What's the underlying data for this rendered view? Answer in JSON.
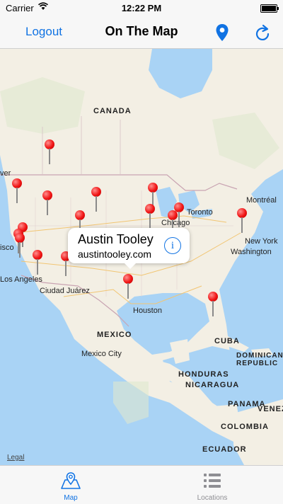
{
  "status_bar": {
    "carrier": "Carrier",
    "time": "12:22 PM"
  },
  "nav": {
    "logout_label": "Logout",
    "title": "On The Map"
  },
  "map": {
    "labels": {
      "canada": "CANADA",
      "montreal": "Montréal",
      "toronto": "Toronto",
      "chicago": "Chicago",
      "new_york": "New York",
      "washington": "Washington",
      "los_angeles": "Los Angeles",
      "ciudad_juarez": "Ciudad Juárez",
      "houston": "Houston",
      "mexico": "MEXICO",
      "mexico_city": "Mexico City",
      "cuba": "CUBA",
      "dominican_republic": "DOMINICAN REPUBLIC",
      "honduras": "HONDURAS",
      "nicaragua": "NICARAGUA",
      "panama": "PANAMA",
      "venezuela": "VENEZU",
      "colombia": "COLOMBIA",
      "ecuador": "ECUADOR",
      "vancouver_partial": "ver",
      "san_francisco_partial": "isco"
    },
    "callout": {
      "name": "Austin Tooley",
      "url": "austintooley.com",
      "info_glyph": "i"
    },
    "legal": "Legal"
  },
  "tabs": [
    {
      "label": "Map",
      "icon": "map-icon",
      "active": true
    },
    {
      "label": "Locations",
      "icon": "list-icon",
      "active": false
    }
  ],
  "colors": {
    "accent": "#1173e3",
    "pin": "#f01414",
    "land": "#f3efe4",
    "water": "#a9d3f5"
  }
}
